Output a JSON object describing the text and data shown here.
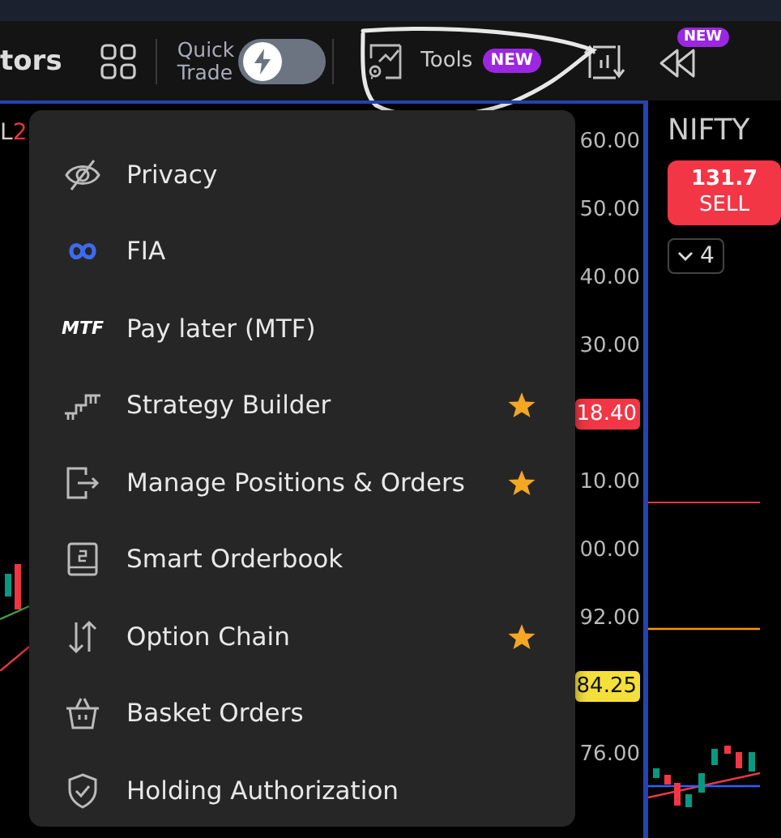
{
  "toolbar": {
    "indicators_label": "tors",
    "quick_trade": {
      "label_lines": [
        "Quick",
        "Trade"
      ],
      "on": false
    },
    "tools": {
      "label": "Tools",
      "badge": "NEW"
    },
    "replay_badge": "NEW"
  },
  "chart": {
    "legend_label": "L",
    "legend_value": "2",
    "price_axis": [
      {
        "kind": "tick",
        "text": "60.00"
      },
      {
        "kind": "tick",
        "text": "50.00"
      },
      {
        "kind": "tick",
        "text": "40.00"
      },
      {
        "kind": "tick",
        "text": "30.00"
      },
      {
        "kind": "tag",
        "text": "18.40",
        "color": "#f23645"
      },
      {
        "kind": "tick",
        "text": "10.00"
      },
      {
        "kind": "tick",
        "text": "00.00"
      },
      {
        "kind": "tick",
        "text": "92.00"
      },
      {
        "kind": "tag",
        "text": "84.25",
        "color": "#f5e03b"
      },
      {
        "kind": "tick",
        "text": "76.00"
      }
    ]
  },
  "side_panel": {
    "symbol": "NIFTY",
    "sell_price": "131.7",
    "sell_label": "SELL",
    "quantity": "4"
  },
  "menu": {
    "items": [
      {
        "kind": "privacy",
        "label": "Privacy",
        "favorite": false
      },
      {
        "kind": "fia",
        "label": "FIA",
        "favorite": false
      },
      {
        "kind": "mtf",
        "icon_text": "MTF",
        "label": "Pay later (MTF)",
        "favorite": false
      },
      {
        "kind": "strategy",
        "label": "Strategy Builder",
        "favorite": true
      },
      {
        "kind": "exit",
        "label": "Manage Positions & Orders",
        "favorite": true
      },
      {
        "kind": "book",
        "label": "Smart Orderbook",
        "favorite": false
      },
      {
        "kind": "updown",
        "label": "Option Chain",
        "favorite": true
      },
      {
        "kind": "basket",
        "label": "Basket Orders",
        "favorite": false
      },
      {
        "kind": "shield",
        "label": "Holding Authorization",
        "favorite": false
      }
    ]
  }
}
